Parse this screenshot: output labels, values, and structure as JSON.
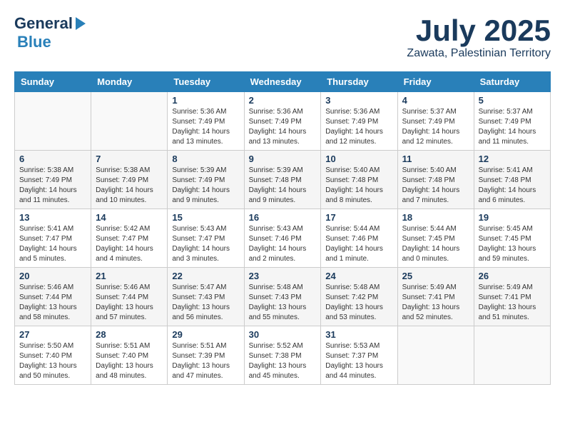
{
  "header": {
    "logo_general": "General",
    "logo_blue": "Blue",
    "title": "July 2025",
    "subtitle": "Zawata, Palestinian Territory"
  },
  "days_of_week": [
    "Sunday",
    "Monday",
    "Tuesday",
    "Wednesday",
    "Thursday",
    "Friday",
    "Saturday"
  ],
  "weeks": [
    [
      {
        "day": "",
        "info": ""
      },
      {
        "day": "",
        "info": ""
      },
      {
        "day": "1",
        "info": "Sunrise: 5:36 AM\nSunset: 7:49 PM\nDaylight: 14 hours\nand 13 minutes."
      },
      {
        "day": "2",
        "info": "Sunrise: 5:36 AM\nSunset: 7:49 PM\nDaylight: 14 hours\nand 13 minutes."
      },
      {
        "day": "3",
        "info": "Sunrise: 5:36 AM\nSunset: 7:49 PM\nDaylight: 14 hours\nand 12 minutes."
      },
      {
        "day": "4",
        "info": "Sunrise: 5:37 AM\nSunset: 7:49 PM\nDaylight: 14 hours\nand 12 minutes."
      },
      {
        "day": "5",
        "info": "Sunrise: 5:37 AM\nSunset: 7:49 PM\nDaylight: 14 hours\nand 11 minutes."
      }
    ],
    [
      {
        "day": "6",
        "info": "Sunrise: 5:38 AM\nSunset: 7:49 PM\nDaylight: 14 hours\nand 11 minutes."
      },
      {
        "day": "7",
        "info": "Sunrise: 5:38 AM\nSunset: 7:49 PM\nDaylight: 14 hours\nand 10 minutes."
      },
      {
        "day": "8",
        "info": "Sunrise: 5:39 AM\nSunset: 7:49 PM\nDaylight: 14 hours\nand 9 minutes."
      },
      {
        "day": "9",
        "info": "Sunrise: 5:39 AM\nSunset: 7:48 PM\nDaylight: 14 hours\nand 9 minutes."
      },
      {
        "day": "10",
        "info": "Sunrise: 5:40 AM\nSunset: 7:48 PM\nDaylight: 14 hours\nand 8 minutes."
      },
      {
        "day": "11",
        "info": "Sunrise: 5:40 AM\nSunset: 7:48 PM\nDaylight: 14 hours\nand 7 minutes."
      },
      {
        "day": "12",
        "info": "Sunrise: 5:41 AM\nSunset: 7:48 PM\nDaylight: 14 hours\nand 6 minutes."
      }
    ],
    [
      {
        "day": "13",
        "info": "Sunrise: 5:41 AM\nSunset: 7:47 PM\nDaylight: 14 hours\nand 5 minutes."
      },
      {
        "day": "14",
        "info": "Sunrise: 5:42 AM\nSunset: 7:47 PM\nDaylight: 14 hours\nand 4 minutes."
      },
      {
        "day": "15",
        "info": "Sunrise: 5:43 AM\nSunset: 7:47 PM\nDaylight: 14 hours\nand 3 minutes."
      },
      {
        "day": "16",
        "info": "Sunrise: 5:43 AM\nSunset: 7:46 PM\nDaylight: 14 hours\nand 2 minutes."
      },
      {
        "day": "17",
        "info": "Sunrise: 5:44 AM\nSunset: 7:46 PM\nDaylight: 14 hours\nand 1 minute."
      },
      {
        "day": "18",
        "info": "Sunrise: 5:44 AM\nSunset: 7:45 PM\nDaylight: 14 hours\nand 0 minutes."
      },
      {
        "day": "19",
        "info": "Sunrise: 5:45 AM\nSunset: 7:45 PM\nDaylight: 13 hours\nand 59 minutes."
      }
    ],
    [
      {
        "day": "20",
        "info": "Sunrise: 5:46 AM\nSunset: 7:44 PM\nDaylight: 13 hours\nand 58 minutes."
      },
      {
        "day": "21",
        "info": "Sunrise: 5:46 AM\nSunset: 7:44 PM\nDaylight: 13 hours\nand 57 minutes."
      },
      {
        "day": "22",
        "info": "Sunrise: 5:47 AM\nSunset: 7:43 PM\nDaylight: 13 hours\nand 56 minutes."
      },
      {
        "day": "23",
        "info": "Sunrise: 5:48 AM\nSunset: 7:43 PM\nDaylight: 13 hours\nand 55 minutes."
      },
      {
        "day": "24",
        "info": "Sunrise: 5:48 AM\nSunset: 7:42 PM\nDaylight: 13 hours\nand 53 minutes."
      },
      {
        "day": "25",
        "info": "Sunrise: 5:49 AM\nSunset: 7:41 PM\nDaylight: 13 hours\nand 52 minutes."
      },
      {
        "day": "26",
        "info": "Sunrise: 5:49 AM\nSunset: 7:41 PM\nDaylight: 13 hours\nand 51 minutes."
      }
    ],
    [
      {
        "day": "27",
        "info": "Sunrise: 5:50 AM\nSunset: 7:40 PM\nDaylight: 13 hours\nand 50 minutes."
      },
      {
        "day": "28",
        "info": "Sunrise: 5:51 AM\nSunset: 7:40 PM\nDaylight: 13 hours\nand 48 minutes."
      },
      {
        "day": "29",
        "info": "Sunrise: 5:51 AM\nSunset: 7:39 PM\nDaylight: 13 hours\nand 47 minutes."
      },
      {
        "day": "30",
        "info": "Sunrise: 5:52 AM\nSunset: 7:38 PM\nDaylight: 13 hours\nand 45 minutes."
      },
      {
        "day": "31",
        "info": "Sunrise: 5:53 AM\nSunset: 7:37 PM\nDaylight: 13 hours\nand 44 minutes."
      },
      {
        "day": "",
        "info": ""
      },
      {
        "day": "",
        "info": ""
      }
    ]
  ]
}
